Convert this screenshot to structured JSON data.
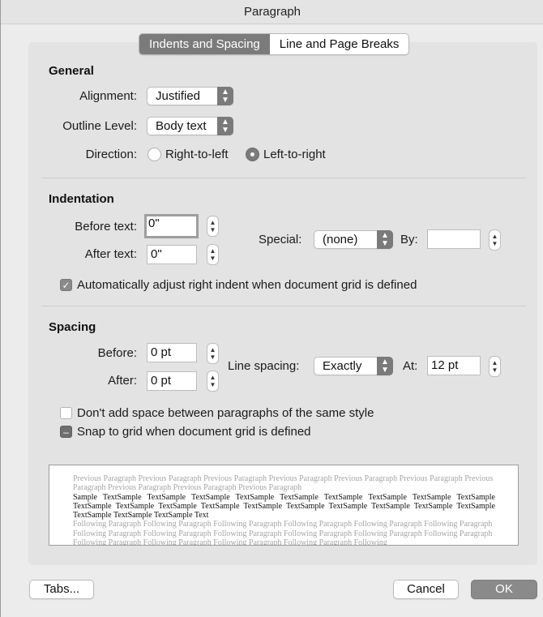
{
  "window": {
    "title": "Paragraph"
  },
  "tabs": [
    {
      "label": "Indents and Spacing",
      "active": true
    },
    {
      "label": "Line and Page Breaks",
      "active": false
    }
  ],
  "general": {
    "heading": "General",
    "alignment": {
      "label": "Alignment:",
      "value": "Justified"
    },
    "outline_level": {
      "label": "Outline Level:",
      "value": "Body text"
    },
    "direction": {
      "label": "Direction:",
      "options": [
        "Right-to-left",
        "Left-to-right"
      ],
      "selected": "Left-to-right"
    }
  },
  "indentation": {
    "heading": "Indentation",
    "before_text": {
      "label": "Before text:",
      "value": "0\""
    },
    "after_text": {
      "label": "After text:",
      "value": "0\""
    },
    "special": {
      "label": "Special:",
      "value": "(none)"
    },
    "by": {
      "label": "By:",
      "value": ""
    },
    "auto_adjust": {
      "label": "Automatically adjust right indent when document grid is defined",
      "checked": true
    }
  },
  "spacing": {
    "heading": "Spacing",
    "before": {
      "label": "Before:",
      "value": "0 pt"
    },
    "after": {
      "label": "After:",
      "value": "0 pt"
    },
    "line_spacing": {
      "label": "Line spacing:",
      "value": "Exactly"
    },
    "at": {
      "label": "At:",
      "value": "12 pt"
    },
    "dont_add_space": {
      "label": "Don't add space between paragraphs of the same style",
      "checked": false
    },
    "snap_to_grid": {
      "label": "Snap to grid when document grid is defined",
      "state": "mixed"
    }
  },
  "preview": {
    "previous": "Previous Paragraph Previous Paragraph Previous Paragraph Previous Paragraph Previous Paragraph Previous Paragraph Previous Paragraph Previous Paragraph Previous Paragraph Previous Paragraph",
    "sample": "Sample TextSample TextSample TextSample TextSample TextSample TextSample TextSample TextSample TextSample TextSample TextSample TextSample TextSample TextSample TextSample TextSample TextSample TextSample TextSample TextSample TextSample TextSample Text",
    "following": "Following Paragraph Following Paragraph Following Paragraph Following Paragraph Following Paragraph Following Paragraph Following Paragraph Following Paragraph Following Paragraph Following Paragraph Following Paragraph Following Paragraph Following Paragraph Following Paragraph Following Paragraph Following Paragraph Following"
  },
  "buttons": {
    "tabs": "Tabs...",
    "cancel": "Cancel",
    "ok": "OK"
  }
}
